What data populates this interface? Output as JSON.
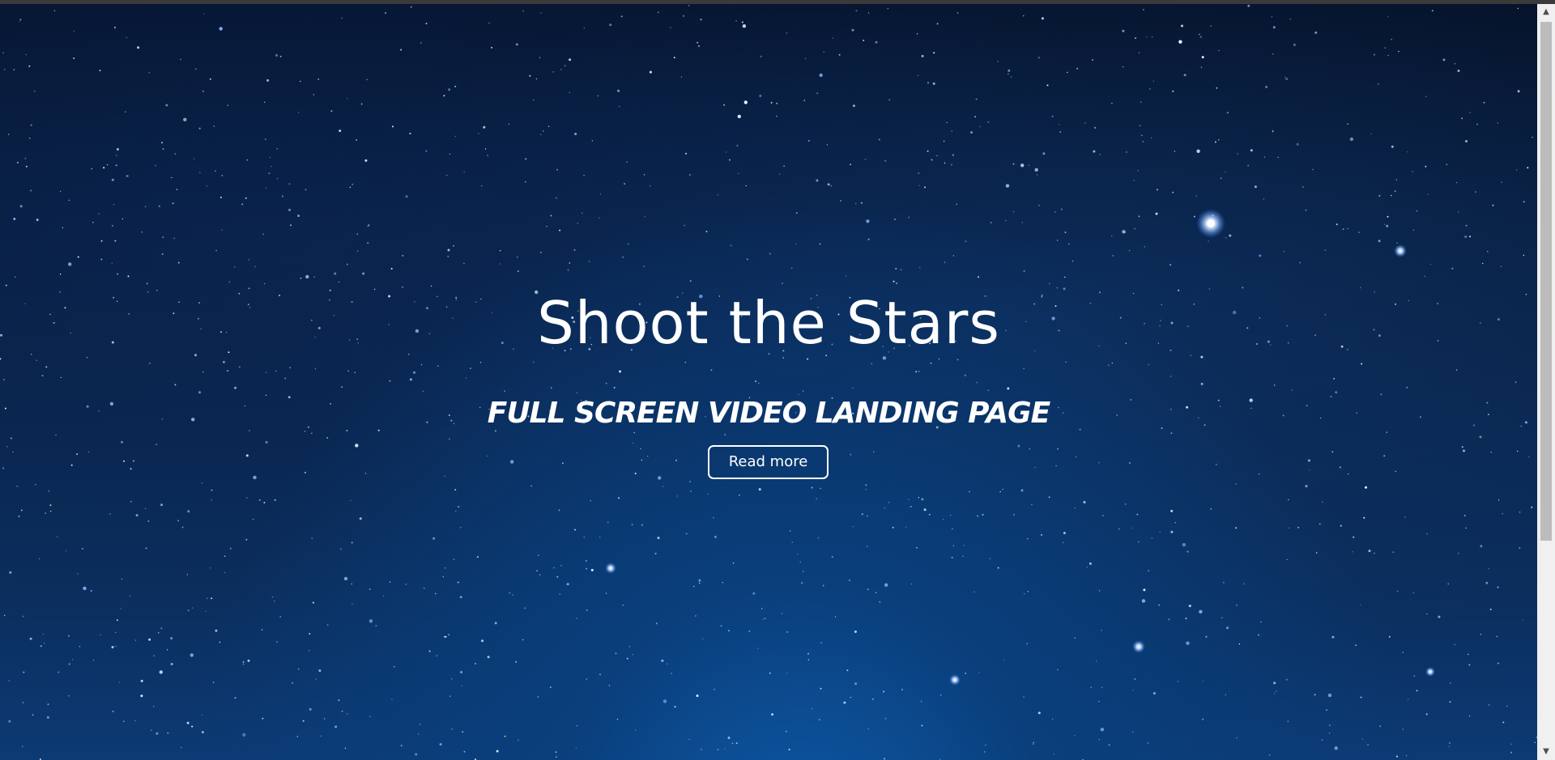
{
  "hero": {
    "title": "Shoot the Stars",
    "subtitle": "FULL SCREEN VIDEO LANDING PAGE",
    "button_label": "Read more"
  },
  "scrollbar": {
    "up_icon": "chevron-up-icon",
    "down_icon": "chevron-down-icon",
    "thumb_fraction": 0.72
  },
  "colors": {
    "text": "#ffffff",
    "sky_dark": "#06132b",
    "sky_mid": "#0a2246",
    "sky_glow": "#0e5aa8",
    "scrollbar_track": "#f0f0f0",
    "scrollbar_thumb": "#bcbcbc"
  }
}
